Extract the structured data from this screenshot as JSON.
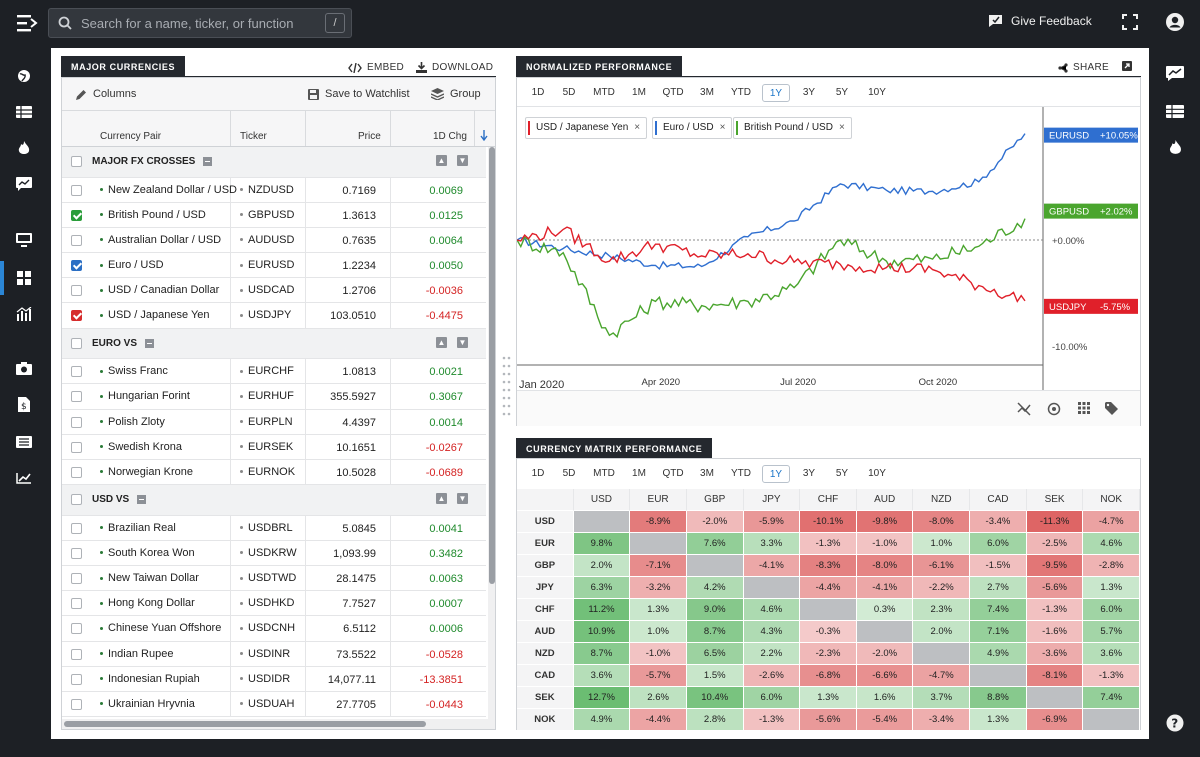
{
  "search": {
    "placeholder": "Search for a name, ticker, or function",
    "shortcut": "/"
  },
  "topbar": {
    "feedback_label": "Give Feedback"
  },
  "left_panel": {
    "tab": "MAJOR CURRENCIES",
    "embed": "EMBED",
    "download": "DOWNLOAD",
    "columns": "Columns",
    "watchlist": "Save to Watchlist",
    "group": "Group",
    "headers": {
      "pair": "Currency Pair",
      "ticker": "Ticker",
      "price": "Price",
      "chg": "1D Chg"
    },
    "rows": [
      {
        "type": "group",
        "name": "MAJOR FX CROSSES"
      },
      {
        "type": "row",
        "name": "New Zealand Dollar / USD",
        "ticker": "NZDUSD",
        "price": "0.7169",
        "chg": "0.0069",
        "dir": "pos",
        "checked": ""
      },
      {
        "type": "row",
        "name": "British Pound / USD",
        "ticker": "GBPUSD",
        "price": "1.3613",
        "chg": "0.0125",
        "dir": "pos",
        "checked": "green"
      },
      {
        "type": "row",
        "name": "Australian Dollar / USD",
        "ticker": "AUDUSD",
        "price": "0.7635",
        "chg": "0.0064",
        "dir": "pos",
        "checked": ""
      },
      {
        "type": "row",
        "name": "Euro / USD",
        "ticker": "EURUSD",
        "price": "1.2234",
        "chg": "0.0050",
        "dir": "pos",
        "checked": "blue"
      },
      {
        "type": "row",
        "name": "USD / Canadian Dollar",
        "ticker": "USDCAD",
        "price": "1.2706",
        "chg": "-0.0036",
        "dir": "neg",
        "checked": ""
      },
      {
        "type": "row",
        "name": "USD / Japanese Yen",
        "ticker": "USDJPY",
        "price": "103.0510",
        "chg": "-0.4475",
        "dir": "neg",
        "checked": "red"
      },
      {
        "type": "group",
        "name": "EURO VS"
      },
      {
        "type": "row",
        "name": "Swiss Franc",
        "ticker": "EURCHF",
        "price": "1.0813",
        "chg": "0.0021",
        "dir": "pos",
        "checked": ""
      },
      {
        "type": "row",
        "name": "Hungarian Forint",
        "ticker": "EURHUF",
        "price": "355.5927",
        "chg": "0.3067",
        "dir": "pos",
        "checked": ""
      },
      {
        "type": "row",
        "name": "Polish Zloty",
        "ticker": "EURPLN",
        "price": "4.4397",
        "chg": "0.0014",
        "dir": "pos",
        "checked": ""
      },
      {
        "type": "row",
        "name": "Swedish Krona",
        "ticker": "EURSEK",
        "price": "10.1651",
        "chg": "-0.0267",
        "dir": "neg",
        "checked": ""
      },
      {
        "type": "row",
        "name": "Norwegian Krone",
        "ticker": "EURNOK",
        "price": "10.5028",
        "chg": "-0.0689",
        "dir": "neg",
        "checked": ""
      },
      {
        "type": "group",
        "name": "USD VS"
      },
      {
        "type": "row",
        "name": "Brazilian Real",
        "ticker": "USDBRL",
        "price": "5.0845",
        "chg": "0.0041",
        "dir": "pos",
        "checked": ""
      },
      {
        "type": "row",
        "name": "South Korea Won",
        "ticker": "USDKRW",
        "price": "1,093.99",
        "chg": "0.3482",
        "dir": "pos",
        "checked": ""
      },
      {
        "type": "row",
        "name": "New Taiwan Dollar",
        "ticker": "USDTWD",
        "price": "28.1475",
        "chg": "0.0063",
        "dir": "pos",
        "checked": ""
      },
      {
        "type": "row",
        "name": "Hong Kong Dollar",
        "ticker": "USDHKD",
        "price": "7.7527",
        "chg": "0.0007",
        "dir": "pos",
        "checked": ""
      },
      {
        "type": "row",
        "name": "Chinese Yuan Offshore",
        "ticker": "USDCNH",
        "price": "6.5112",
        "chg": "0.0006",
        "dir": "pos",
        "checked": ""
      },
      {
        "type": "row",
        "name": "Indian Rupee",
        "ticker": "USDINR",
        "price": "73.5522",
        "chg": "-0.0528",
        "dir": "neg",
        "checked": ""
      },
      {
        "type": "row",
        "name": "Indonesian Rupiah",
        "ticker": "USDIDR",
        "price": "14,077.11",
        "chg": "-13.3851",
        "dir": "neg",
        "checked": ""
      },
      {
        "type": "row",
        "name": "Ukrainian Hryvnia",
        "ticker": "USDUAH",
        "price": "27.7705",
        "chg": "-0.0443",
        "dir": "neg",
        "checked": ""
      }
    ]
  },
  "perf_panel": {
    "tab": "NORMALIZED PERFORMANCE",
    "share": "SHARE",
    "ranges": [
      "1D",
      "5D",
      "MTD",
      "1M",
      "QTD",
      "3M",
      "YTD",
      "1Y",
      "3Y",
      "5Y",
      "10Y"
    ],
    "selected_range": "1Y",
    "chips": [
      {
        "label": "USD / Japanese Yen",
        "color": "#e0202a"
      },
      {
        "label": "Euro / USD",
        "color": "#2f6fd0"
      },
      {
        "label": "British Pound / USD",
        "color": "#4aa52e"
      }
    ],
    "x_labels": [
      "Jan 2020",
      "Apr 2020",
      "Jul 2020",
      "Oct 2020"
    ],
    "y_labels": [
      "+0.00%",
      "-10.00%"
    ],
    "end_labels": [
      {
        "ticker": "EURUSD",
        "value": "+10.05%",
        "color": "#2f6fd0"
      },
      {
        "ticker": "GBPUSD",
        "value": "+2.02%",
        "color": "#4aa52e"
      },
      {
        "ticker": "USDJPY",
        "value": "-5.75%",
        "color": "#e0202a"
      }
    ]
  },
  "chart_data": {
    "type": "line",
    "x": [
      "Jan 2020",
      "Feb 2020",
      "Mar 2020",
      "Apr 2020",
      "May 2020",
      "Jun 2020",
      "Jul 2020",
      "Aug 2020",
      "Sep 2020",
      "Oct 2020",
      "Nov 2020",
      "Dec 2020"
    ],
    "series": [
      {
        "name": "EURUSD",
        "values": [
          0.0,
          -0.8,
          -1.5,
          -2.4,
          -2.5,
          0.3,
          1.8,
          5.3,
          4.7,
          4.6,
          5.5,
          10.05
        ]
      },
      {
        "name": "GBPUSD",
        "values": [
          0.0,
          -1.2,
          -9.0,
          -5.8,
          -6.2,
          -5.8,
          -4.5,
          0.0,
          -2.0,
          -1.8,
          -0.6,
          2.02
        ]
      },
      {
        "name": "USDJPY",
        "values": [
          0.0,
          1.0,
          -2.0,
          -0.4,
          -1.5,
          -1.3,
          -2.1,
          -2.3,
          -2.6,
          -2.8,
          -4.3,
          -5.75
        ]
      }
    ],
    "y_ticks": [
      "+0.00%",
      "-10.00%"
    ],
    "ylim": [
      -12,
      12
    ]
  },
  "matrix_panel": {
    "tab": "CURRENCY MATRIX PERFORMANCE",
    "ranges": [
      "1D",
      "5D",
      "MTD",
      "1M",
      "QTD",
      "3M",
      "YTD",
      "1Y",
      "3Y",
      "5Y",
      "10Y"
    ],
    "selected_range": "1Y",
    "cols": [
      "USD",
      "EUR",
      "GBP",
      "JPY",
      "CHF",
      "AUD",
      "NZD",
      "CAD",
      "SEK",
      "NOK"
    ],
    "rows": [
      {
        "label": "USD",
        "cells": [
          "",
          "-8.9%",
          "-2.0%",
          "-5.9%",
          "-10.1%",
          "-9.8%",
          "-8.0%",
          "-3.4%",
          "-11.3%",
          "-4.7%"
        ]
      },
      {
        "label": "EUR",
        "cells": [
          "9.8%",
          "",
          "7.6%",
          "3.3%",
          "-1.3%",
          "-1.0%",
          "1.0%",
          "6.0%",
          "-2.5%",
          "4.6%"
        ]
      },
      {
        "label": "GBP",
        "cells": [
          "2.0%",
          "-7.1%",
          "",
          "-4.1%",
          "-8.3%",
          "-8.0%",
          "-6.1%",
          "-1.5%",
          "-9.5%",
          "-2.8%"
        ]
      },
      {
        "label": "JPY",
        "cells": [
          "6.3%",
          "-3.2%",
          "4.2%",
          "",
          "-4.4%",
          "-4.1%",
          "-2.2%",
          "2.7%",
          "-5.6%",
          "1.3%"
        ]
      },
      {
        "label": "CHF",
        "cells": [
          "11.2%",
          "1.3%",
          "9.0%",
          "4.6%",
          "",
          "0.3%",
          "2.3%",
          "7.4%",
          "-1.3%",
          "6.0%"
        ]
      },
      {
        "label": "AUD",
        "cells": [
          "10.9%",
          "1.0%",
          "8.7%",
          "4.3%",
          "-0.3%",
          "",
          "2.0%",
          "7.1%",
          "-1.6%",
          "5.7%"
        ]
      },
      {
        "label": "NZD",
        "cells": [
          "8.7%",
          "-1.0%",
          "6.5%",
          "2.2%",
          "-2.3%",
          "-2.0%",
          "",
          "4.9%",
          "-3.6%",
          "3.6%"
        ]
      },
      {
        "label": "CAD",
        "cells": [
          "3.6%",
          "-5.7%",
          "1.5%",
          "-2.6%",
          "-6.8%",
          "-6.6%",
          "-4.7%",
          "",
          "-8.1%",
          "-1.3%"
        ]
      },
      {
        "label": "SEK",
        "cells": [
          "12.7%",
          "2.6%",
          "10.4%",
          "6.0%",
          "1.3%",
          "1.6%",
          "3.7%",
          "8.8%",
          "",
          "7.4%"
        ]
      },
      {
        "label": "NOK",
        "cells": [
          "4.9%",
          "-4.4%",
          "2.8%",
          "-1.3%",
          "-5.6%",
          "-5.4%",
          "-3.4%",
          "1.3%",
          "-6.9%",
          ""
        ]
      }
    ]
  }
}
